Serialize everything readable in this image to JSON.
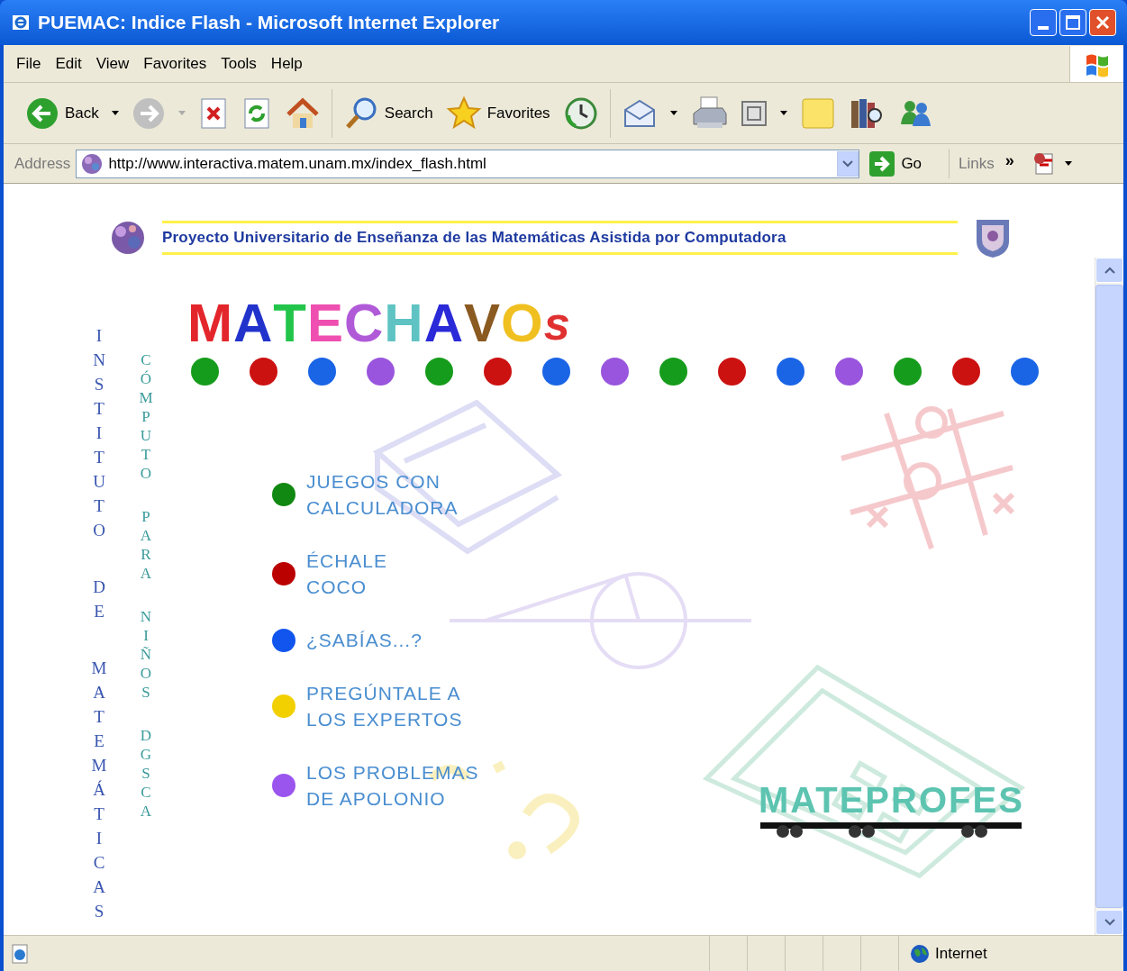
{
  "window": {
    "title": "PUEMAC: Indice Flash - Microsoft Internet Explorer"
  },
  "menu": [
    "File",
    "Edit",
    "View",
    "Favorites",
    "Tools",
    "Help"
  ],
  "toolbar": [
    {
      "kind": "back",
      "label": "Back"
    },
    {
      "kind": "forward"
    },
    {
      "kind": "stop"
    },
    {
      "kind": "refresh"
    },
    {
      "kind": "home"
    },
    {
      "kind": "search",
      "label": "Search"
    },
    {
      "kind": "favorites",
      "label": "Favorites"
    },
    {
      "kind": "history"
    },
    {
      "kind": "mail"
    },
    {
      "kind": "print"
    },
    {
      "kind": "edit"
    },
    {
      "kind": "notes"
    },
    {
      "kind": "research"
    },
    {
      "kind": "messenger"
    }
  ],
  "address": {
    "label": "Address",
    "url": "http://www.interactiva.matem.unam.mx/index_flash.html",
    "go": "Go",
    "links": "Links",
    "chevron": "»"
  },
  "page": {
    "banner": "Proyecto Universitario de Enseñanza de las Matemáticas Asistida por Computadora",
    "logo_letters": [
      {
        "text": "M",
        "color": "#e3262b"
      },
      {
        "text": "A",
        "color": "#2233cc"
      },
      {
        "text": "T",
        "color": "#22c54a"
      },
      {
        "text": "E",
        "color": "#ee4fb0"
      },
      {
        "text": "C",
        "color": "#b05ad8"
      },
      {
        "text": "H",
        "color": "#5fc3c3"
      },
      {
        "text": "A",
        "color": "#2a2ad8"
      },
      {
        "text": "V",
        "color": "#8a5a20"
      },
      {
        "text": "O",
        "color": "#f0c020"
      },
      {
        "text": "s",
        "color": "#e03030"
      }
    ],
    "dots": [
      {
        "color": "#169c1c"
      },
      {
        "color": "#cc1111"
      },
      {
        "color": "#1a64e6"
      },
      {
        "color": "#9955dd"
      },
      {
        "color": "#169c1c"
      },
      {
        "color": "#cc1111"
      },
      {
        "color": "#1a64e6"
      },
      {
        "color": "#9955dd"
      },
      {
        "color": "#169c1c"
      },
      {
        "color": "#cc1111"
      },
      {
        "color": "#1a64e6"
      },
      {
        "color": "#9955dd"
      },
      {
        "color": "#169c1c"
      },
      {
        "color": "#cc1111"
      },
      {
        "color": "#1a64e6"
      }
    ],
    "left_column": "INSTITUTO DE MATEMÁTICAS",
    "right_column": "CÓMPUTO PARA NIÑOS DGSCA",
    "menu_items": [
      {
        "label": "JUEGOS CON\nCALCULADORA",
        "color": "#118811"
      },
      {
        "label": "ÉCHALE\nCOCO",
        "color": "#bb0000"
      },
      {
        "label": "¿SABÍAS...?",
        "color": "#1155ee"
      },
      {
        "label": "PREGÚNTALE A\nLOS EXPERTOS",
        "color": "#f2d000"
      },
      {
        "label": "LOS PROBLEMAS\nDE APOLONIO",
        "color": "#9a55ee"
      }
    ],
    "mateprofes": "MATEPROFES"
  },
  "status_bar": {
    "zone": "Internet"
  }
}
